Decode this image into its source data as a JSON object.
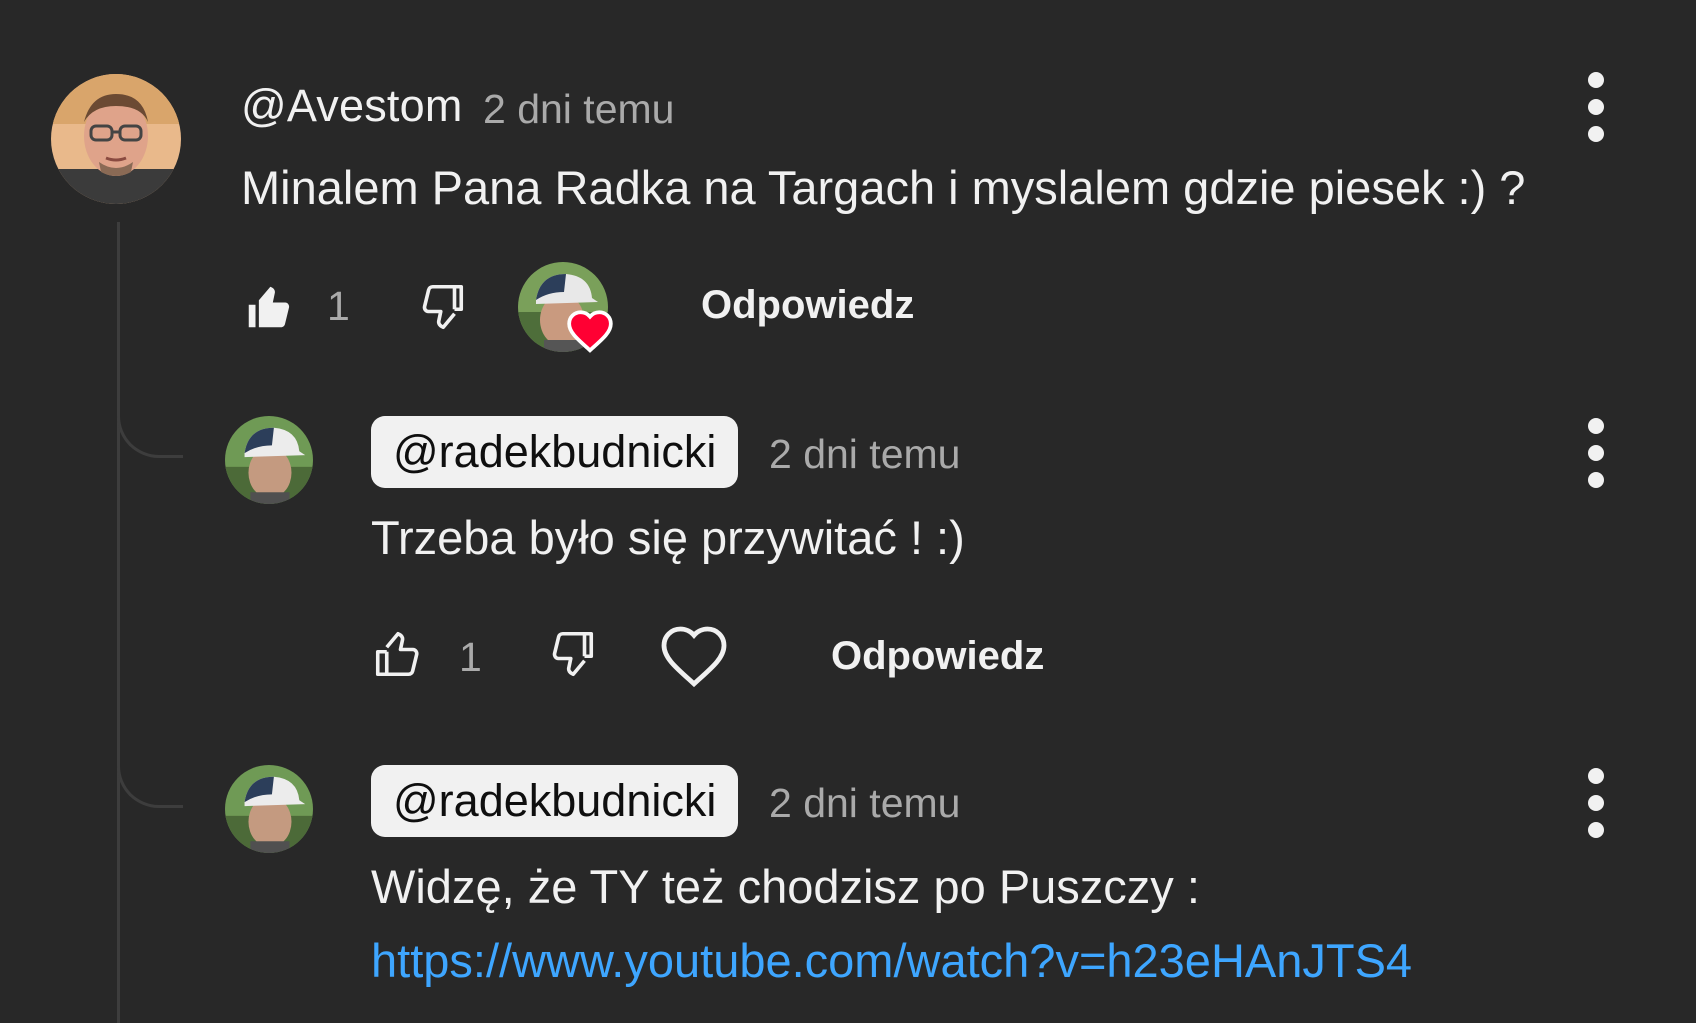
{
  "comments": [
    {
      "author": "@Avestom",
      "timestamp": "2 dni temu",
      "text": "Minalem Pana Radka na Targach i myslalem gdzie piesek :) ?",
      "likes": "1",
      "reply_label": "Odpowiedz",
      "creator_hearted": true,
      "avatar": "avatar-avestom"
    }
  ],
  "replies": [
    {
      "author": "@radekbudnicki",
      "timestamp": "2 dni temu",
      "text": "Trzeba było się przywitać ! :)",
      "likes": "1",
      "reply_label": "Odpowiedz",
      "avatar": "avatar-radekbudnicki"
    },
    {
      "author": "@radekbudnicki",
      "timestamp": "2 dni temu",
      "text": "Widzę, że TY też chodzisz po Puszczy :",
      "link": "https://www.youtube.com/watch?v=h23eHAnJTS4",
      "avatar": "avatar-radekbudnicki"
    }
  ],
  "icons": {
    "like": "thumb-up-icon",
    "dislike": "thumb-down-icon",
    "heart": "heart-icon",
    "menu": "more-vert-icon"
  },
  "colors": {
    "background": "#282828",
    "text": "#f1f1f1",
    "secondary": "#aaaaaa",
    "link": "#3ea6ff",
    "heart": "#ff0033"
  }
}
